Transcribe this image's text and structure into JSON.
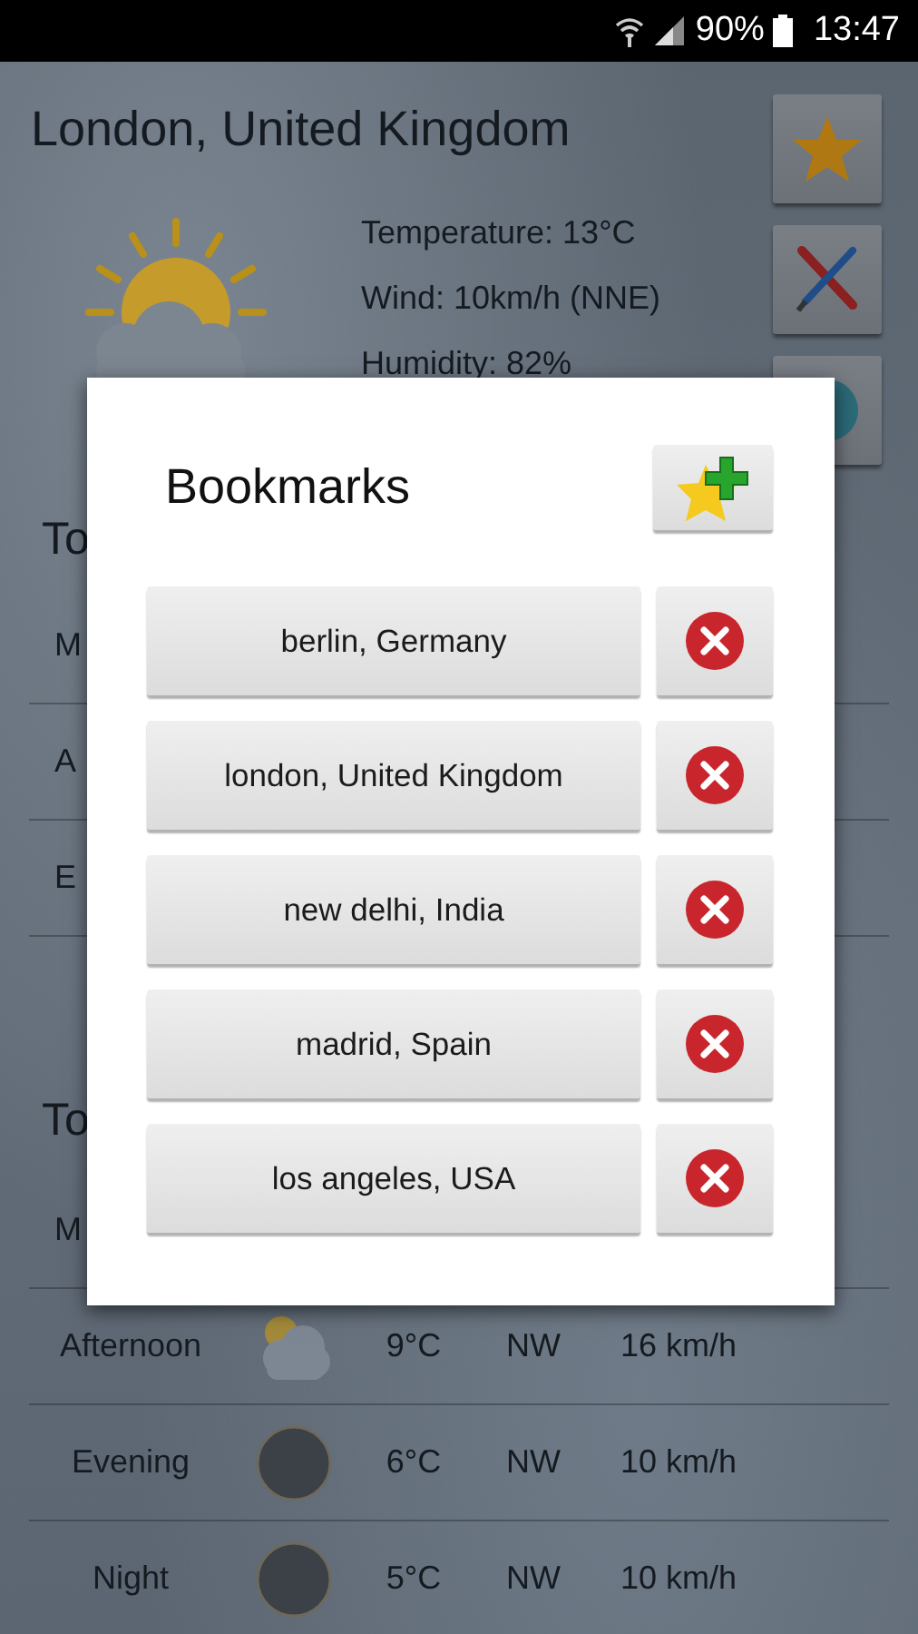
{
  "status_bar": {
    "battery": "90%",
    "time": "13:47"
  },
  "location": "London, United Kingdom",
  "current_conditions": [
    "Temperature: 13°C",
    "Wind: 10km/h (NNE)",
    "Humidity: 82%"
  ],
  "sections": [
    {
      "heading": "To",
      "rows": [
        {
          "period": "M"
        },
        {
          "period": "A"
        },
        {
          "period": "E"
        }
      ]
    },
    {
      "heading": "To",
      "rows": [
        {
          "period": "M"
        },
        {
          "period": "Afternoon",
          "kind": "partly_cloudy",
          "temperature": "9°C",
          "direction": "NW",
          "speed": "16 km/h"
        },
        {
          "period": "Evening",
          "kind": "moon",
          "temperature": "6°C",
          "direction": "NW",
          "speed": "10 km/h"
        },
        {
          "period": "Night",
          "kind": "moon",
          "temperature": "5°C",
          "direction": "NW",
          "speed": "10 km/h"
        }
      ]
    }
  ],
  "dialog": {
    "title": "Bookmarks",
    "bookmarks": [
      "berlin, Germany",
      "london, United Kingdom",
      "new delhi, India",
      "madrid, Spain",
      "los angeles, USA"
    ]
  }
}
